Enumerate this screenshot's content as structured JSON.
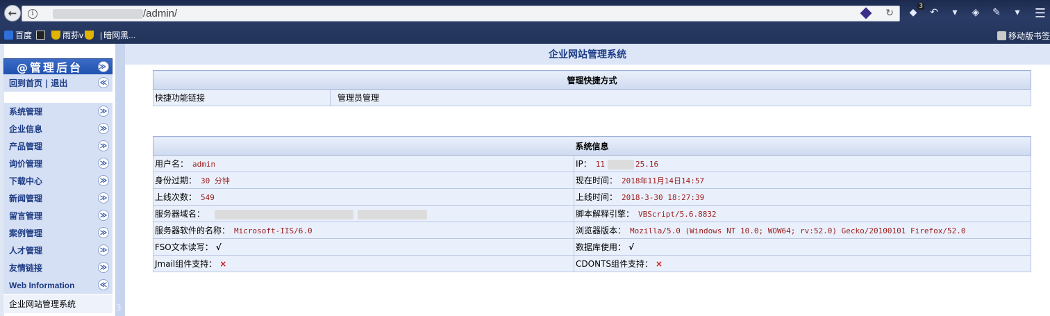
{
  "browser": {
    "url_path": "/admin/",
    "badge_count": "3",
    "bookmarks": [
      "百度",
      "雨荪v",
      "暗网黑..."
    ],
    "mobile_bookmarks": "移动版书签"
  },
  "sidebar": {
    "brand_title": "@管理后台",
    "home_link": "回到首页",
    "separator": "|",
    "logout_link": "退出",
    "items": [
      {
        "label": "系统管理"
      },
      {
        "label": "企业信息"
      },
      {
        "label": "产品管理"
      },
      {
        "label": "询价管理"
      },
      {
        "label": "下载中心"
      },
      {
        "label": "新闻管理"
      },
      {
        "label": "留言管理"
      },
      {
        "label": "案例管理"
      },
      {
        "label": "人才管理"
      },
      {
        "label": "友情链接"
      },
      {
        "label": "Web Information"
      }
    ],
    "web_info_sub": "企业网站管理系统",
    "expand_glyph": "≫",
    "collapse_glyph": "≪",
    "handle_text": "3"
  },
  "main": {
    "title": "企业网站管理系统",
    "shortcut": {
      "header": "管理快捷方式",
      "cell1": "快捷功能链接",
      "cell2": "管理员管理"
    },
    "sysinfo": {
      "header": "系统信息",
      "rows": [
        {
          "l_label": "用户名：",
          "l_value": "admin",
          "r_label": "IP：",
          "r_value": "11",
          "r_value2": "25.16"
        },
        {
          "l_label": "身份过期：",
          "l_value": "30 分钟",
          "r_label": "现在时间：",
          "r_value": "2018年11月14日14:57"
        },
        {
          "l_label": "上线次数：",
          "l_value": "549",
          "r_label": "上线时间：",
          "r_value": "2018-3-30 18:27:39"
        },
        {
          "l_label": "服务器域名：",
          "l_value": "",
          "r_label": "脚本解释引擎：",
          "r_value": "VBScript/5.6.8832"
        },
        {
          "l_label": "服务器软件的名称：",
          "l_value": "Microsoft-IIS/6.0",
          "r_label": "浏览器版本：",
          "r_value": "Mozilla/5.0 (Windows NT 10.0; WOW64; rv:52.0) Gecko/20100101 Firefox/52.0"
        },
        {
          "l_label": "FSO文本读写：",
          "l_value": "√",
          "r_label": "数据库使用：",
          "r_value": "√"
        },
        {
          "l_label": "Jmail组件支持：",
          "l_value": "×",
          "r_label": "CDONTS组件支持：",
          "r_value": "×"
        }
      ]
    }
  },
  "colors": {
    "accent": "#1d3c85",
    "value_red": "#9b1c1c",
    "panel_bg": "#eaf0fb"
  }
}
